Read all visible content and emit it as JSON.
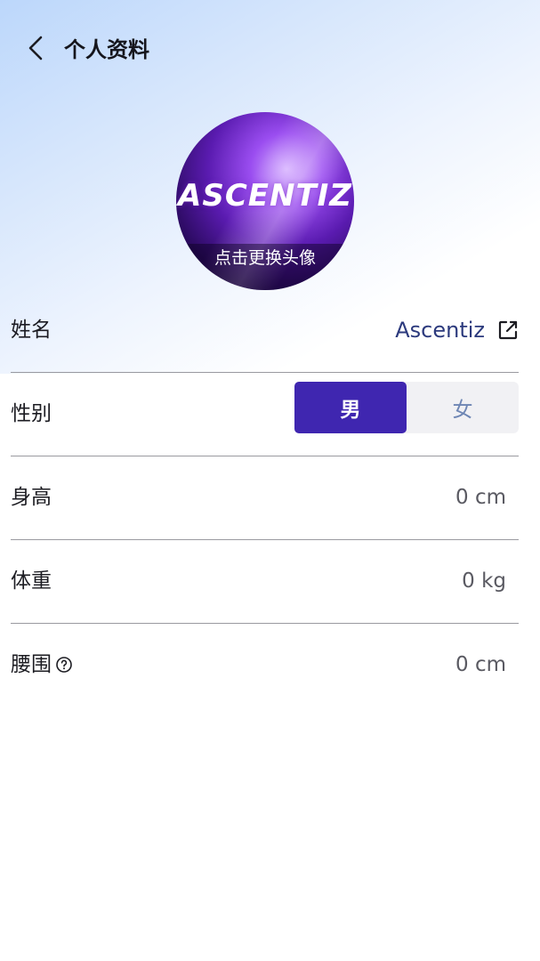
{
  "header": {
    "title": "个人资料"
  },
  "avatar": {
    "logo_text": "ASCENTIZ",
    "caption": "点击更换头像"
  },
  "form": {
    "name": {
      "label": "姓名",
      "value": "Ascentiz"
    },
    "gender": {
      "label": "性别",
      "options": [
        "男",
        "女"
      ],
      "selected": "男"
    },
    "height": {
      "label": "身高",
      "value": "0 cm"
    },
    "weight": {
      "label": "体重",
      "value": "0 kg"
    },
    "waist": {
      "label": "腰围",
      "value": "0 cm"
    }
  },
  "colors": {
    "accent": "#3f26b0",
    "name_text": "#2c3a7d",
    "female_text": "#6e86b4",
    "divider": "#9a9aa0"
  },
  "icons": [
    "chevron-left-icon",
    "edit-icon",
    "question-circle-icon"
  ]
}
